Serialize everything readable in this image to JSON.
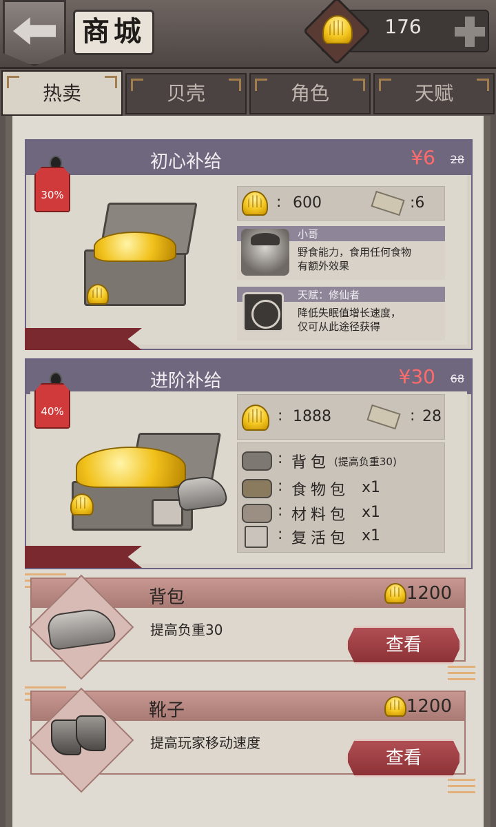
{
  "header": {
    "title": "商城",
    "currency_value": "176"
  },
  "tabs": [
    {
      "label": "热卖",
      "active": true
    },
    {
      "label": "贝壳",
      "active": false
    },
    {
      "label": "角色",
      "active": false
    },
    {
      "label": "天赋",
      "active": false
    }
  ],
  "bundles": [
    {
      "title": "初心补给",
      "price": "¥6",
      "old_price": "28",
      "discount": "30%",
      "shells": "600",
      "scrolls": ":6",
      "character_name": "小哥",
      "character_desc": [
        "野食能力，食用任何食物",
        "有额外效果"
      ],
      "talent_name": "天赋：修仙者",
      "talent_desc": [
        "降低失眠值增长速度，",
        "仅可从此途径获得"
      ]
    },
    {
      "title": "进阶补给",
      "price": "¥30",
      "old_price": "68",
      "discount": "40%",
      "shells": "1888",
      "scrolls": "28",
      "items": [
        {
          "label": "背包",
          "note": "(提高负重30)",
          "qty": ""
        },
        {
          "label": "食物包",
          "note": "",
          "qty": "x1"
        },
        {
          "label": "材料包",
          "note": "",
          "qty": "x1"
        },
        {
          "label": "复活包",
          "note": "",
          "qty": "x1"
        }
      ]
    }
  ],
  "items": [
    {
      "name": "背包",
      "price": "1200",
      "desc": "提高负重30",
      "button": "查看"
    },
    {
      "name": "靴子",
      "price": "1200",
      "desc": "提高玩家移动速度",
      "button": "查看"
    }
  ],
  "colors": {
    "price_red": "#ff6b6b",
    "button_red": "#9c3c40",
    "discount_tag": "#d13a3a"
  }
}
